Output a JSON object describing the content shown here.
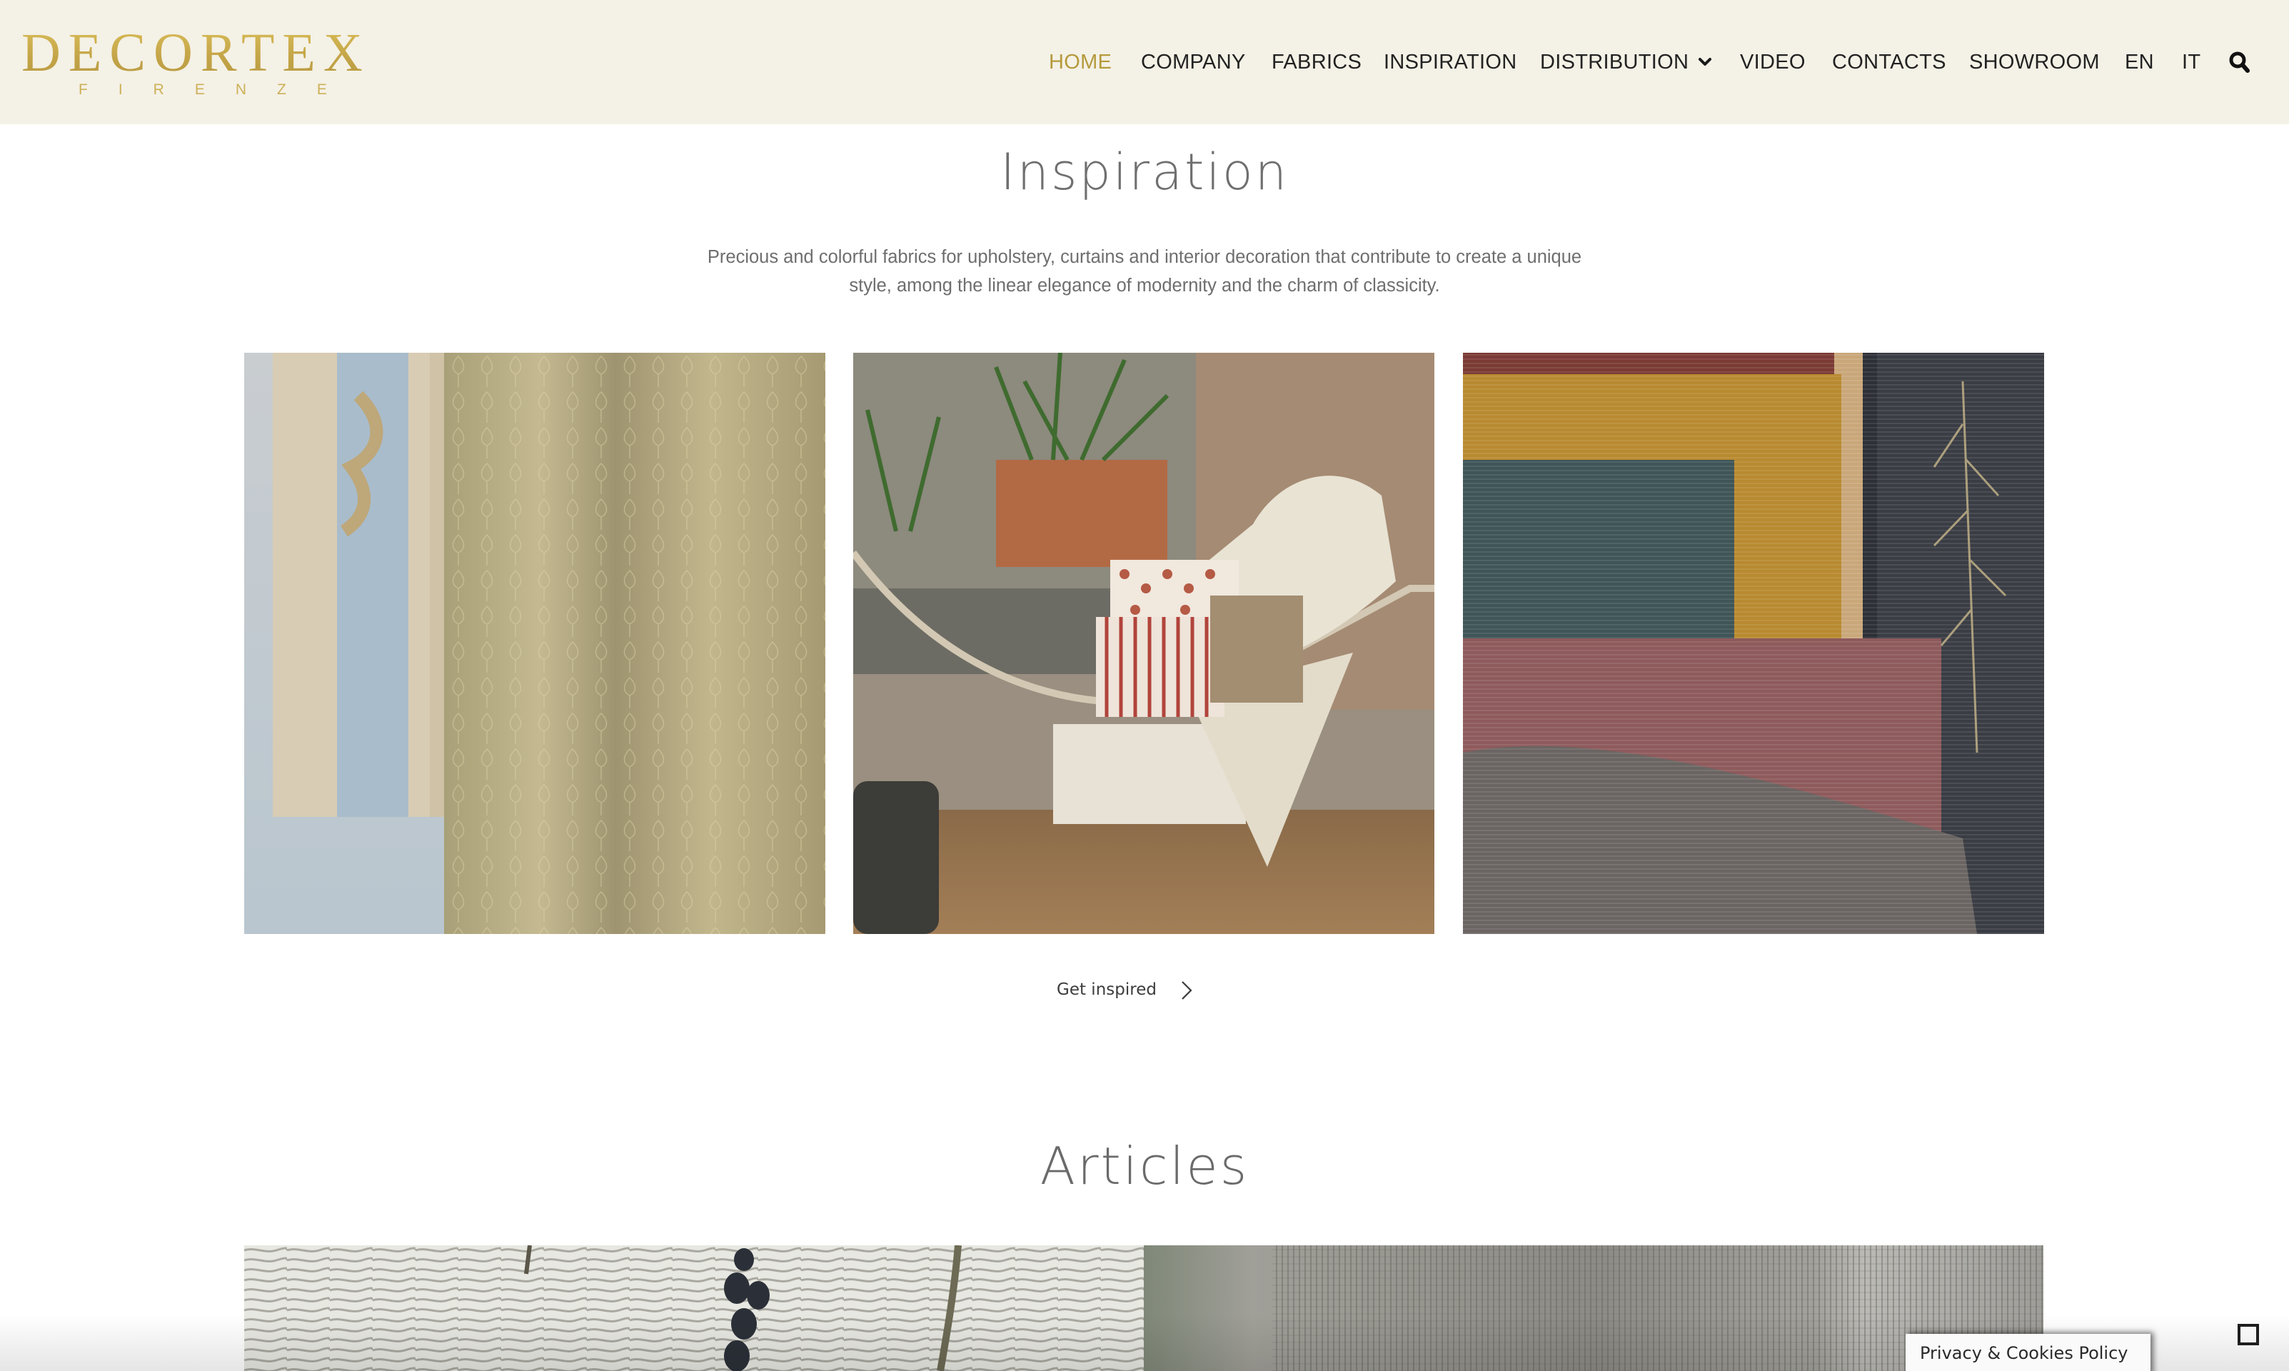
{
  "brand": {
    "name": "DECORTEX",
    "subtitle": "FIRENZE",
    "color": "#c3a447"
  },
  "nav": {
    "items": [
      {
        "label": "HOME",
        "active": true
      },
      {
        "label": "COMPANY"
      },
      {
        "label": "FABRICS"
      },
      {
        "label": "INSPIRATION"
      },
      {
        "label": "DISTRIBUTION",
        "has_dropdown": true
      },
      {
        "label": "VIDEO"
      },
      {
        "label": "CONTACTS"
      },
      {
        "label": "SHOWROOM"
      },
      {
        "label": "EN"
      },
      {
        "label": "IT"
      }
    ],
    "dropdown_icon": "chevron-down-icon",
    "search_icon": "search-icon",
    "active_color": "#b59a3d",
    "text_color": "#222222",
    "background": "#f4f1e6"
  },
  "inspiration": {
    "title": "Inspiration",
    "description": "Precious and colorful fabrics for upholstery, curtains and interior decoration that contribute to create a unique style, among the linear elegance of modernity and the charm of classicity.",
    "tiles": [
      {
        "alt": "Damask curtain beside painted wooden panel"
      },
      {
        "alt": "Hammock with cushions and ivory throw"
      },
      {
        "alt": "Stacked textured fabrics in ochre, teal, rose and grey"
      }
    ],
    "cta_label": "Get inspired",
    "cta_icon": "chevron-right-icon"
  },
  "articles": {
    "title": "Articles",
    "items": [
      {
        "alt": "White wavy textured fabric with dark berries"
      },
      {
        "alt": "Grey open-weave curtain fabric"
      }
    ]
  },
  "privacy": {
    "label": "Privacy & Cookies Policy"
  }
}
